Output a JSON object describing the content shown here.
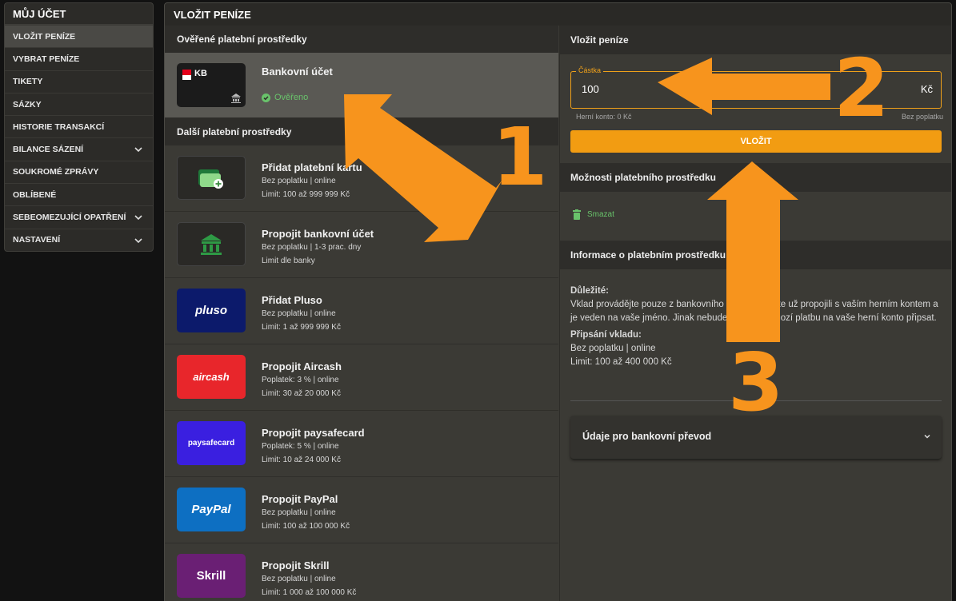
{
  "sidebar": {
    "title": "MŮJ ÚČET",
    "items": [
      {
        "label": "VLOŽIT PENÍZE",
        "active": true
      },
      {
        "label": "VYBRAT PENÍZE"
      },
      {
        "label": "TIKETY"
      },
      {
        "label": "SÁZKY"
      },
      {
        "label": "HISTORIE TRANSAKCÍ"
      },
      {
        "label": "BILANCE SÁZENÍ",
        "expandable": true
      },
      {
        "label": "SOUKROMÉ ZPRÁVY"
      },
      {
        "label": "OBLÍBENÉ"
      },
      {
        "label": "SEBEOMEZUJÍCÍ OPATŘENÍ",
        "expandable": true
      },
      {
        "label": "NASTAVENÍ",
        "expandable": true
      }
    ]
  },
  "main": {
    "title": "VLOŽIT PENÍZE",
    "verified_heading": "Ověřené platební prostředky",
    "verified_method": {
      "name": "Bankovní účet",
      "status": "Ověřeno",
      "logo_text": "KB"
    },
    "other_heading": "Další platební prostředky",
    "methods": [
      {
        "name": "Přidat platební kartu",
        "line1": "Bez poplatku | online",
        "line2": "Limit: 100 až 999 999 Kč",
        "icon": "card-icon"
      },
      {
        "name": "Propojit bankovní účet",
        "line1": "Bez poplatku | 1-3 prac. dny",
        "line2": "Limit dle banky",
        "icon": "bank-icon"
      },
      {
        "name": "Přidat Pluso",
        "line1": "Bez poplatku | online",
        "line2": "Limit: 1 až 999 999 Kč",
        "logo_text": "pluso",
        "color": "#0c1a6b"
      },
      {
        "name": "Propojit Aircash",
        "line1": "Poplatek: 3 % | online",
        "line2": "Limit: 30 až 20 000 Kč",
        "logo_text": "aircash",
        "color": "#e8262b"
      },
      {
        "name": "Propojit paysafecard",
        "line1": "Poplatek: 5 % | online",
        "line2": "Limit: 10 až 24 000 Kč",
        "logo_text": "paysafecard",
        "color": "#3a1fe0"
      },
      {
        "name": "Propojit PayPal",
        "line1": "Bez poplatku | online",
        "line2": "Limit: 100 až 100 000 Kč",
        "logo_text": "PayPal",
        "color": "#0d6fc2"
      },
      {
        "name": "Propojit Skrill",
        "line1": "Bez poplatku | online",
        "line2": "Limit: 1 000 až 100 000 Kč",
        "logo_text": "Skrill",
        "color": "#6a1f74"
      }
    ]
  },
  "deposit": {
    "heading": "Vložit peníze",
    "amount_label": "Částka",
    "amount_value": "100",
    "currency": "Kč",
    "hint_left": "Herní konto: 0 Kč",
    "hint_right": "Bez poplatku",
    "button": "VLOŽIT",
    "options_heading": "Možnosti platebního prostředku",
    "delete_label": "Smazat",
    "info_heading": "Informace o platebním prostředku",
    "important_label": "Důležité:",
    "important_text": "Vklad provádějte pouze z bankovního účtu, který jste už propojili s vaším herním kontem a je veden na vaše jméno. Jinak nebude možné příchozí platbu na vaše herní konto připsat.",
    "credit_label": "Připsání vkladu:",
    "credit_line1": "Bez poplatku | online",
    "credit_line2": "Limit: 100 až 400 000 Kč",
    "bank_transfer": "Údaje pro bankovní převod"
  },
  "annotations": {
    "one": "1",
    "two": "2",
    "three": "3",
    "color": "#f7941d"
  }
}
